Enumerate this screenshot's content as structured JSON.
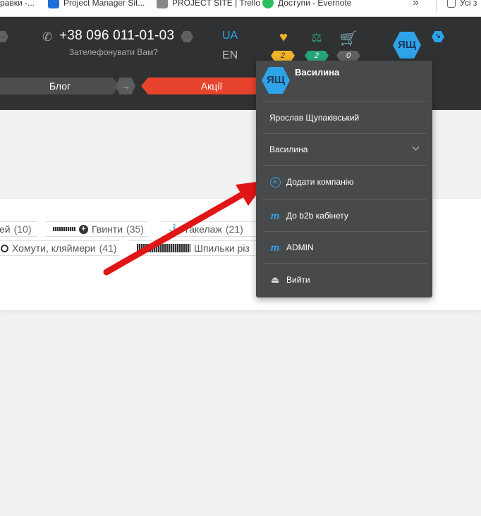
{
  "bookmarks": {
    "items": [
      {
        "label": "равки -..."
      },
      {
        "label": "Project Manager Sit..."
      },
      {
        "label": "PROJECT SITE | Trello"
      },
      {
        "label": "Доступи - Evernote"
      }
    ],
    "more": "»",
    "right_label": "Усі з"
  },
  "header": {
    "phone": "+38 096 011-01-03",
    "callback": "Зателефонувати Вам?",
    "lang_active": "UA",
    "lang_other": "EN",
    "favorites_count": "2",
    "compare_count": "2",
    "cart_count": "0",
    "avatar_initials": "ЯЩ",
    "colors": {
      "favorites": "#f0b429",
      "compare": "#26a77a",
      "cart": "#6a6c6e",
      "accent": "#2ea3e8",
      "promo": "#e8442d"
    }
  },
  "nav": {
    "blog": "Блог",
    "promo": "Акції"
  },
  "categories": {
    "row1": [
      {
        "label": "ей",
        "count": "(10)"
      },
      {
        "label": "Гвинти",
        "count": "(35)"
      },
      {
        "label": "Такелаж",
        "count": "(21)"
      }
    ],
    "row2": [
      {
        "label": "Хомути, кляймери",
        "count": "(41)"
      },
      {
        "label": "Шпильки різ"
      }
    ]
  },
  "dropdown": {
    "avatar_initials": "ЯЩ",
    "user_name": "Василина",
    "full_name": "Ярослав Щупаківський",
    "company": "Василина",
    "add_company": "Додати компанію",
    "b2b": "До b2b кабінету",
    "admin": "ADMIN",
    "logout": "Вийти"
  }
}
